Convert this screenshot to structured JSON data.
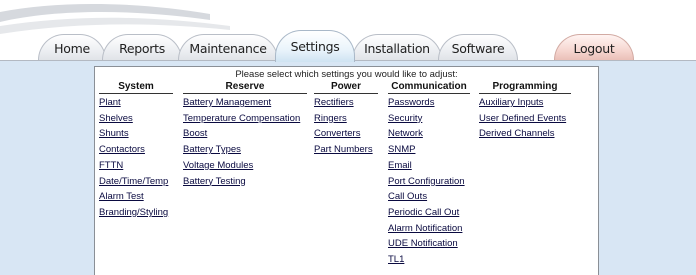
{
  "tabs": [
    {
      "id": "home",
      "label": "Home"
    },
    {
      "id": "reports",
      "label": "Reports"
    },
    {
      "id": "maintenance",
      "label": "Maintenance"
    },
    {
      "id": "settings",
      "label": "Settings"
    },
    {
      "id": "installation",
      "label": "Installation"
    },
    {
      "id": "software",
      "label": "Software"
    },
    {
      "id": "logout",
      "label": "Logout"
    }
  ],
  "active_tab": "Settings",
  "panel": {
    "prompt": "Please select which settings you would like to adjust:",
    "columns": [
      {
        "heading": "System",
        "items": [
          "Plant",
          "Shelves",
          "Shunts",
          "Contactors",
          "FTTN",
          "Date/Time/Temp",
          "Alarm Test",
          "Branding/Styling"
        ]
      },
      {
        "heading": "Reserve",
        "items": [
          "Battery Management",
          "Temperature Compensation",
          "Boost",
          "Battery Types",
          "Voltage Modules",
          "Battery Testing"
        ]
      },
      {
        "heading": "Power",
        "items": [
          "Rectifiers",
          "Ringers",
          "Converters",
          "Part Numbers"
        ]
      },
      {
        "heading": "Communication",
        "items": [
          "Passwords",
          "Security",
          "Network",
          "SNMP",
          "Email",
          "Port Configuration",
          "Call Outs",
          "Periodic Call Out",
          "Alarm Notification",
          "UDE Notification",
          "TL1"
        ]
      },
      {
        "heading": "Programming",
        "items": [
          "Auxiliary Inputs",
          "User Defined Events",
          "Derived Channels"
        ]
      }
    ]
  },
  "colors": {
    "content_bg": "#d8e6f4",
    "tab_border": "#b9bec7",
    "logout_tab": "#f6d6d0",
    "link": "#0a0a40"
  }
}
